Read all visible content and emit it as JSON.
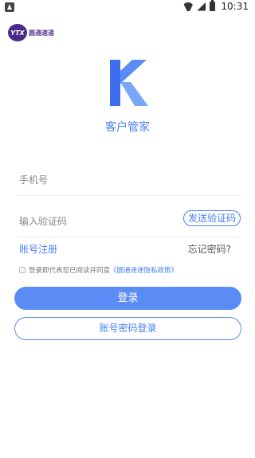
{
  "status_bar": {
    "time": "10:31"
  },
  "brand": {
    "badge": "YTX",
    "name": "圆通速递"
  },
  "app": {
    "name": "客户管家"
  },
  "phone": {
    "placeholder": "手机号",
    "value": ""
  },
  "code": {
    "placeholder": "输入验证码",
    "value": "",
    "send_label": "发送验证码"
  },
  "links": {
    "register": "账号注册",
    "forgot": "忘记密码?"
  },
  "agreement": {
    "text": "登录即代表您已阅读并同意",
    "policy": "《圆通速递隐私政策》",
    "checked": false
  },
  "buttons": {
    "login": "登录",
    "password_login": "账号密码登录"
  },
  "colors": {
    "accent": "#4a7ef3",
    "primary_button": "#5b8cf6"
  }
}
